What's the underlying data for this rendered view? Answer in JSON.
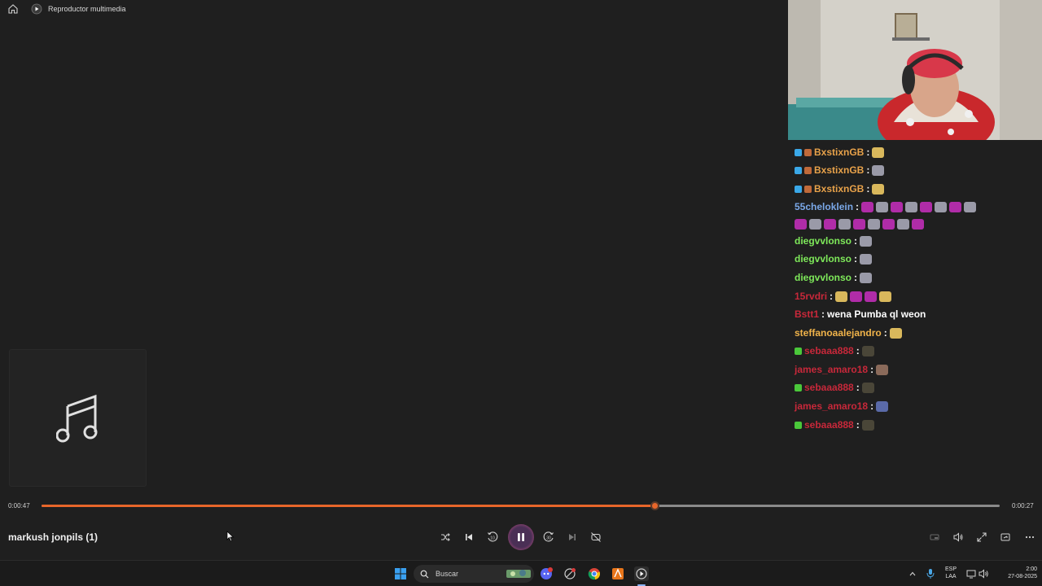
{
  "app": {
    "title": "Reproductor multimedia",
    "icons": [
      "home-icon",
      "media-player-icon"
    ]
  },
  "chat": {
    "messages": [
      {
        "user": "BxstixnGB",
        "color": "#e8a24a",
        "text": "",
        "emotes": [
          "#d9b85c"
        ],
        "badges": [
          "#3aa8e8",
          "#c06a3a"
        ]
      },
      {
        "user": "BxstixnGB",
        "color": "#e8a24a",
        "text": "",
        "emotes": [
          "#9a9aa8"
        ],
        "badges": [
          "#3aa8e8",
          "#c06a3a"
        ]
      },
      {
        "user": "BxstixnGB",
        "color": "#e8a24a",
        "text": "",
        "emotes": [
          "#d9b85c"
        ],
        "badges": [
          "#3aa8e8",
          "#c06a3a"
        ]
      },
      {
        "user": "55cheloklein",
        "color": "#7aa8e8",
        "text": "",
        "emotes": [
          "#b02ca8",
          "#9a9aa8",
          "#b02ca8",
          "#9a9aa8",
          "#b02ca8",
          "#9a9aa8",
          "#b02ca8",
          "#9a9aa8"
        ],
        "badges": []
      },
      {
        "user": "",
        "color": "#7aa8e8",
        "text": "",
        "emotes": [
          "#b02ca8",
          "#9a9aa8",
          "#b02ca8",
          "#9a9aa8",
          "#b02ca8",
          "#9a9aa8",
          "#b02ca8",
          "#9a9aa8",
          "#b02ca8"
        ],
        "badges": []
      },
      {
        "user": "diegvvlonso",
        "color": "#7ee85a",
        "text": "",
        "emotes": [
          "#9a9aa8"
        ],
        "badges": []
      },
      {
        "user": "diegvvlonso",
        "color": "#7ee85a",
        "text": "",
        "emotes": [
          "#9a9aa8"
        ],
        "badges": []
      },
      {
        "user": "diegvvlonso",
        "color": "#7ee85a",
        "text": "",
        "emotes": [
          "#9a9aa8"
        ],
        "badges": []
      },
      {
        "user": "15rvdri",
        "color": "#c8283a",
        "text": "",
        "emotes": [
          "#d9b85c",
          "#b02ca8",
          "#b02ca8",
          "#d9b85c"
        ],
        "badges": []
      },
      {
        "user": "Bstt1",
        "color": "#c8283a",
        "text": "wena Pumba ql weon",
        "emotes": [],
        "badges": []
      },
      {
        "user": "steffanoaalejandro",
        "color": "#f0b34a",
        "text": "",
        "emotes": [
          "#d9b85c"
        ],
        "badges": []
      },
      {
        "user": "sebaaa888",
        "color": "#c8283a",
        "text": "",
        "emotes": [
          "#4a4638"
        ],
        "badges": [
          "#4ac83a"
        ]
      },
      {
        "user": "james_amaro18",
        "color": "#c8283a",
        "text": "",
        "emotes": [
          "#8a6a5a"
        ],
        "badges": []
      },
      {
        "user": "sebaaa888",
        "color": "#c8283a",
        "text": "",
        "emotes": [
          "#4a4638"
        ],
        "badges": [
          "#4ac83a"
        ]
      },
      {
        "user": "james_amaro18",
        "color": "#c8283a",
        "text": "",
        "emotes": [
          "#5a6aa8"
        ],
        "badges": []
      },
      {
        "user": "sebaaa888",
        "color": "#c8283a",
        "text": "",
        "emotes": [
          "#4a4638"
        ],
        "badges": [
          "#4ac83a"
        ]
      }
    ]
  },
  "player": {
    "elapsed": "0:00:47",
    "remaining": "0:00:27",
    "progress": 0.64,
    "song_title": "markush jonpils (1)",
    "album_art_icon": "music-note-icon",
    "controls": [
      "shuffle-icon",
      "previous-icon",
      "rewind-10-icon",
      "pause-icon",
      "forward-30-icon",
      "next-icon",
      "repeat-off-icon"
    ],
    "right_controls": [
      "miniplayer-icon",
      "volume-icon",
      "fullscreen-icon",
      "cast-icon",
      "more-icon"
    ]
  },
  "taskbar": {
    "search_placeholder": "Buscar",
    "language_top": "ESP",
    "language_bottom": "LAA",
    "time": "2:00",
    "date": "27-08-2025"
  },
  "colors": {
    "accent": "#e8662a",
    "background": "#1f1f1f"
  }
}
